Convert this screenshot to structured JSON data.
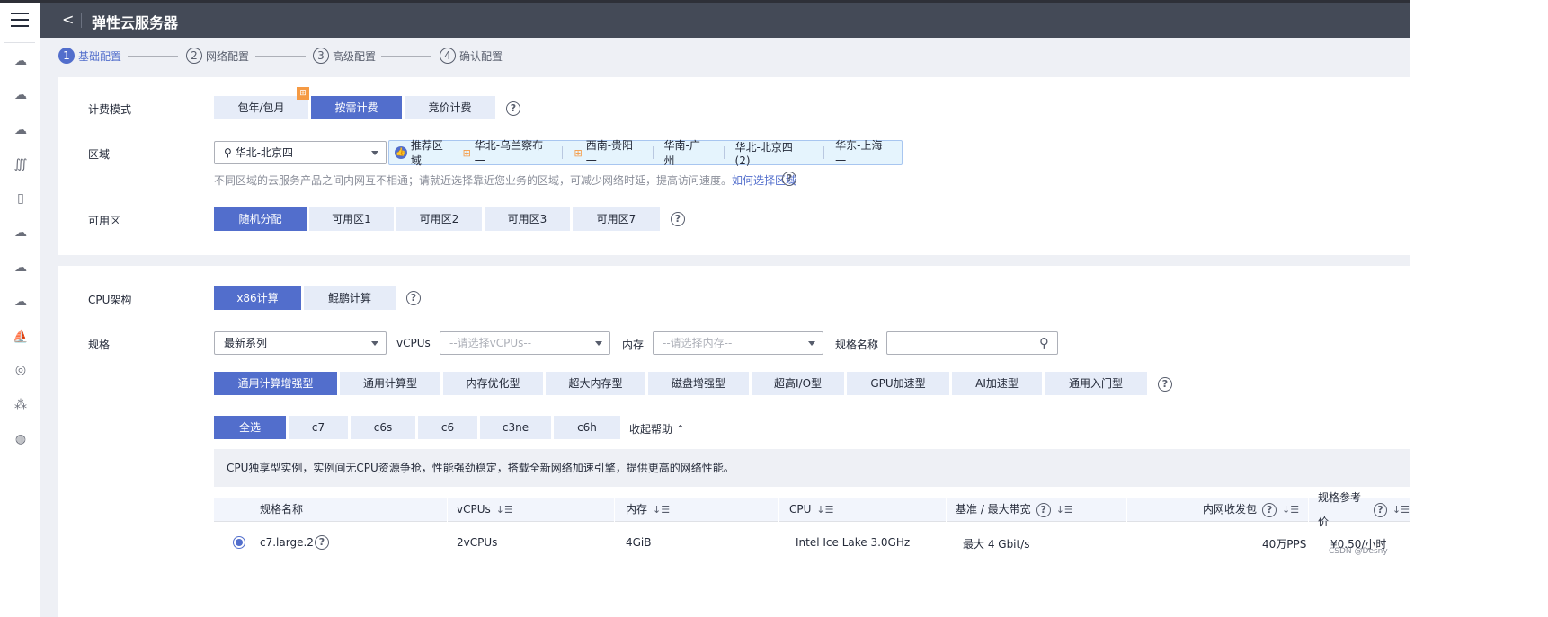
{
  "header": {
    "title": "弹性云服务器",
    "back_icon": "chevron-left-icon"
  },
  "steps": [
    {
      "num": "1",
      "label": "基础配置"
    },
    {
      "num": "2",
      "label": "网络配置"
    },
    {
      "num": "3",
      "label": "高级配置"
    },
    {
      "num": "4",
      "label": "确认配置"
    }
  ],
  "billing": {
    "label": "计费模式",
    "options": [
      "包年/包月",
      "按需计费",
      "竞价计费"
    ],
    "selected": "按需计费"
  },
  "region": {
    "label": "区域",
    "value": "华北-北京四",
    "recommend_label": "推荐区域",
    "recommended": [
      "华北-乌兰察布一",
      "西南-贵阳一",
      "华南-广州",
      "华北-北京四 (2)",
      "华东-上海一"
    ],
    "hint": "不同区域的云服务产品之间内网互不相通；请就近选择靠近您业务的区域，可减少网络时延，提高访问速度。",
    "hint_link": "如何选择区域"
  },
  "az": {
    "label": "可用区",
    "options": [
      "随机分配",
      "可用区1",
      "可用区2",
      "可用区3",
      "可用区7"
    ],
    "selected": "随机分配"
  },
  "cpu_arch": {
    "label": "CPU架构",
    "options": [
      "x86计算",
      "鲲鹏计算"
    ],
    "selected": "x86计算"
  },
  "spec": {
    "label": "规格",
    "series_value": "最新系列",
    "vcpus_label": "vCPUs",
    "vcpus_placeholder": "--请选择vCPUs--",
    "mem_label": "内存",
    "mem_placeholder": "--请选择内存--",
    "name_label": "规格名称",
    "name_value": ""
  },
  "types": [
    "通用计算增强型",
    "通用计算型",
    "内存优化型",
    "超大内存型",
    "磁盘增强型",
    "超高I/O型",
    "GPU加速型",
    "AI加速型",
    "通用入门型"
  ],
  "series": [
    "全选",
    "c7",
    "c6s",
    "c6",
    "c3ne",
    "c6h"
  ],
  "collapse_help": "收起帮助",
  "info": "CPU独享型实例，实例间无CPU资源争抢，性能强劲稳定，搭载全新网络加速引擎，提供更高的网络性能。",
  "table": {
    "headers": [
      "规格名称",
      "vCPUs",
      "内存",
      "CPU",
      "基准 / 最大带宽",
      "内网收发包",
      "规格参考价"
    ],
    "rows": [
      {
        "name": "c7.large.2",
        "vcpus": "2vCPUs",
        "mem": "4GiB",
        "cpu": "Intel Ice Lake 3.0GHz",
        "bw": "最大 4 Gbit/s",
        "pps": "40万PPS",
        "price": "¥0.50/小时"
      }
    ]
  },
  "watermark": "CSDN @Desny",
  "colors": {
    "primary": "#526ecc",
    "header": "#444a57",
    "light_btn": "#e6ecf8"
  }
}
